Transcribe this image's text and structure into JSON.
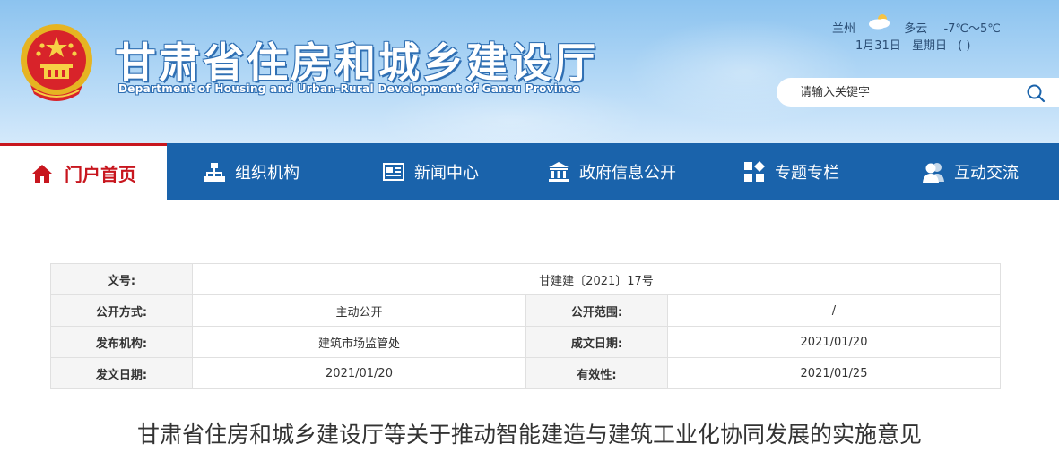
{
  "header": {
    "title": "甘肃省住房和城乡建设厅",
    "subtitle": "Department of Housing and Urban-Rural Development of Gansu Province",
    "emblem_icon": "national-emblem-icon"
  },
  "weather": {
    "city": "兰州",
    "icon": "cloudy-sun-icon",
    "condition": "多云",
    "temperature": "-7℃～5℃",
    "date": "1月31日",
    "weekday": "星期日",
    "extra": "(   )"
  },
  "search": {
    "placeholder": "请输入关键字",
    "icon": "search-icon"
  },
  "nav": {
    "items": [
      {
        "label": "门户首页",
        "icon": "home-icon",
        "active": true
      },
      {
        "label": "组织机构",
        "icon": "org-chart-icon"
      },
      {
        "label": "新闻中心",
        "icon": "newspaper-icon"
      },
      {
        "label": "政府信息公开",
        "icon": "government-building-icon"
      },
      {
        "label": "专题专栏",
        "icon": "grid-diamond-icon"
      },
      {
        "label": "互动交流",
        "icon": "users-icon"
      }
    ]
  },
  "doc_info": {
    "doc_no_label": "文号:",
    "doc_no_value": "甘建建〔2021〕17号",
    "disclosure_method_label": "公开方式:",
    "disclosure_method_value": "主动公开",
    "disclosure_scope_label": "公开范围:",
    "disclosure_scope_value": "/",
    "issuer_label": "发布机构:",
    "issuer_value": "建筑市场监管处",
    "created_date_label": "成文日期:",
    "created_date_value": "2021/01/20",
    "issue_date_label": "发文日期:",
    "issue_date_value": "2021/01/20",
    "validity_label": "有效性:",
    "validity_value": "2021/01/25"
  },
  "document": {
    "title": "甘肃省住房和城乡建设厅等关于推动智能建造与建筑工业化协同发展的实施意见"
  },
  "colors": {
    "nav_bg": "#1a63ab",
    "active_red": "#c8161e",
    "header_sky": "#8cc3ef"
  }
}
